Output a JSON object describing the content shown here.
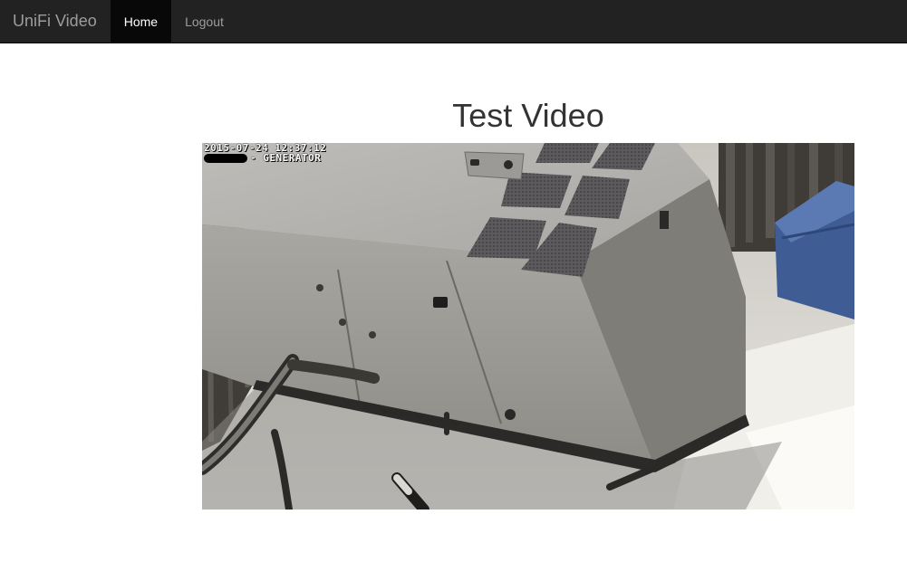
{
  "navbar": {
    "brand": "UniFi Video",
    "items": [
      {
        "label": "Home",
        "active": true
      },
      {
        "label": "Logout",
        "active": false
      }
    ]
  },
  "main": {
    "title": "Test Video",
    "video": {
      "timestamp": "2015-07-24 12:37:12",
      "camera_label": "- GENERATOR",
      "subject": "generator-camera-feed"
    }
  },
  "colors": {
    "navbar_bg": "#222222",
    "nav_active_bg": "#080808",
    "nav_text": "#9d9d9d",
    "nav_active_text": "#ffffff",
    "title_text": "#333333"
  }
}
